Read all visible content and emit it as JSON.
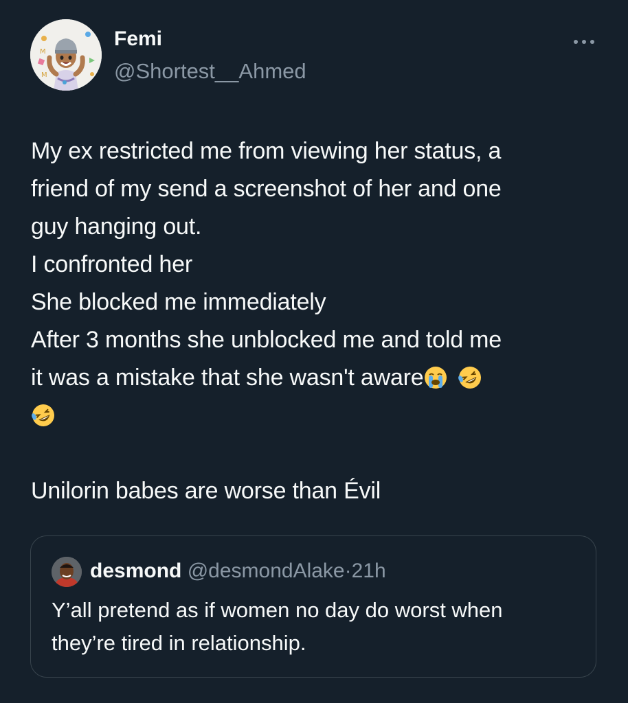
{
  "author": {
    "display_name": "Femi",
    "handle": "@Shortest__Ahmed",
    "avatar_icon": "memoji-avatar-icon"
  },
  "more_icon": "more-dots-icon",
  "tweet": {
    "lines": [
      "My ex restricted me from viewing her status, a",
      "friend of my send a screenshot of her and one",
      "guy hanging out.",
      "I confronted her",
      "She blocked me immediately",
      "After 3 months she unblocked me and told me",
      "it was a mistake that she wasn't aware",
      "Unilorin babes are worse than Évil"
    ],
    "emojis": [
      "loudly-crying-face-emoji",
      "rolling-on-floor-laughing-emoji",
      "rolling-on-floor-laughing-emoji"
    ]
  },
  "quote": {
    "display_name": "desmond",
    "handle": "@desmondAlake",
    "separator": "·",
    "time": "21h",
    "avatar_icon": "profile-photo-icon",
    "lines": [
      "Y’all pretend as if women no day do worst when",
      "they’re tired in relationship."
    ]
  },
  "colors": {
    "background": "#15202b",
    "primary_text": "#f7f9f9",
    "secondary_text": "#8b98a5",
    "border": "#38444d"
  }
}
